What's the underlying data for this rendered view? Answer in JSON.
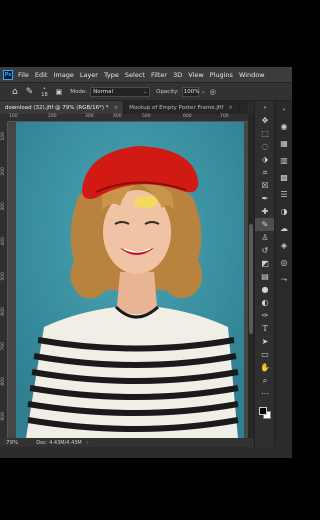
{
  "menu": {
    "logo": "Ps",
    "items": [
      "File",
      "Edit",
      "Image",
      "Layer",
      "Type",
      "Select",
      "Filter",
      "3D",
      "View",
      "Plugins",
      "Window"
    ]
  },
  "options": {
    "home_icon": "home-icon",
    "brush_icon": "brush-icon",
    "brush_size": "18",
    "mode_label": "Mode:",
    "mode_value": "Normal",
    "opacity_label": "Opacity:",
    "opacity_value": "100%"
  },
  "tabs": [
    {
      "label": "download (32).jfif @ 79% (RGB/16*) *",
      "active": true
    },
    {
      "label": "Mockup of Empty Poster Frame.jfif",
      "active": false
    }
  ],
  "ruler": {
    "top": [
      "100",
      "200",
      "300",
      "400",
      "500",
      "600",
      "700"
    ],
    "left": [
      "100",
      "200",
      "300",
      "400",
      "500",
      "600",
      "700",
      "800",
      "900"
    ]
  },
  "status": {
    "zoom": "79%",
    "doc": "Doc: 4.43M/4.43M"
  },
  "tools": [
    "move-icon",
    "marquee-icon",
    "lasso-icon",
    "object-select-icon",
    "crop-icon",
    "frame-icon",
    "eyedropper-icon",
    "healing-icon",
    "brush-icon",
    "stamp-icon",
    "history-brush-icon",
    "eraser-icon",
    "gradient-icon",
    "blur-icon",
    "dodge-icon",
    "pen-icon",
    "type-icon",
    "path-select-icon",
    "rectangle-icon",
    "hand-icon",
    "zoom-icon",
    "more-tools-icon"
  ],
  "selected_tool": "brush-icon",
  "colors": {
    "foreground": "#000000",
    "background": "#ffffff",
    "canvas_bg": "#3f97a8",
    "accent": "#31a8ff"
  }
}
